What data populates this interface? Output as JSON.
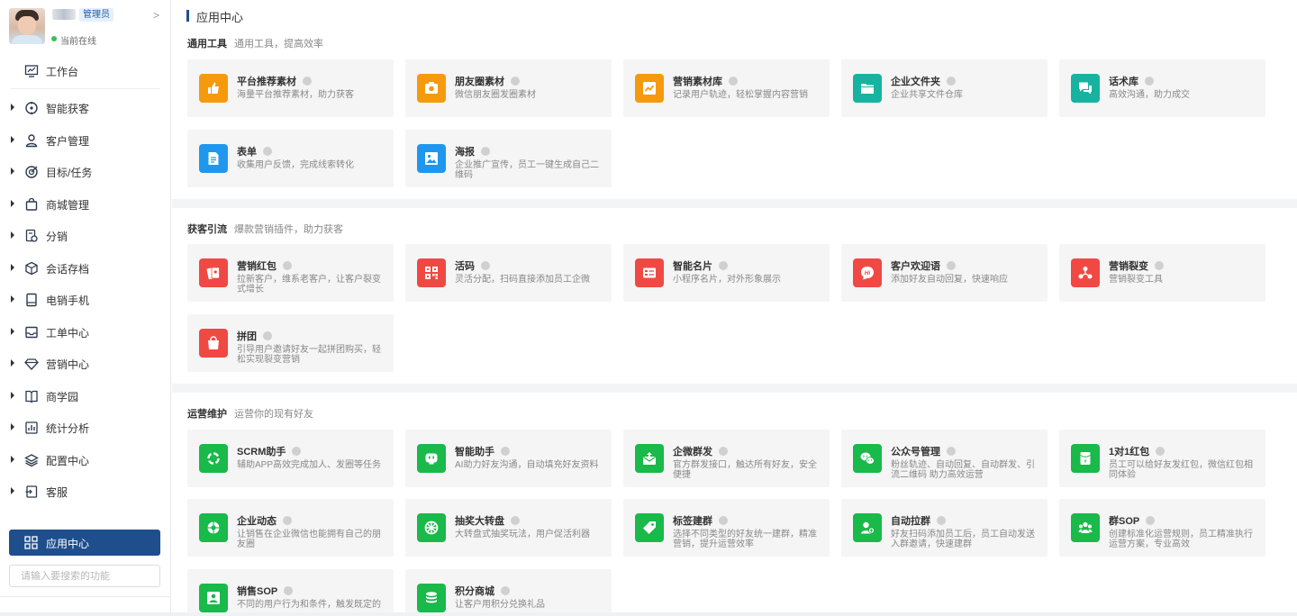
{
  "sidebar": {
    "profile": {
      "role": "管理员",
      "status": "当前在线"
    },
    "workbench": "工作台",
    "nav": [
      {
        "label": "智能获客",
        "icon": "compass-icon"
      },
      {
        "label": "客户管理",
        "icon": "user-icon"
      },
      {
        "label": "目标/任务",
        "icon": "target-icon"
      },
      {
        "label": "商城管理",
        "icon": "shopping-bag-icon"
      },
      {
        "label": "分销",
        "icon": "distribution-icon"
      },
      {
        "label": "会话存档",
        "icon": "chat-archive-icon"
      },
      {
        "label": "电销手机",
        "icon": "phone-icon"
      },
      {
        "label": "工单中心",
        "icon": "ticket-icon"
      },
      {
        "label": "营销中心",
        "icon": "diamond-icon"
      },
      {
        "label": "商学园",
        "icon": "book-icon"
      },
      {
        "label": "统计分析",
        "icon": "chart-icon"
      },
      {
        "label": "配置中心",
        "icon": "layers-icon"
      },
      {
        "label": "客服",
        "icon": "service-icon"
      }
    ],
    "active_item": "应用中心",
    "search_placeholder": "请输入要搜索的功能"
  },
  "main": {
    "title": "应用中心",
    "sections": [
      {
        "title": "通用工具",
        "subtitle": "通用工具，提高效率",
        "cards": [
          {
            "title": "平台推荐素材",
            "desc": "海量平台推荐素材，助力获客",
            "color": "#f59a0d",
            "icon": "thumbs-up-icon"
          },
          {
            "title": "朋友圈素材",
            "desc": "微信朋友圈发圈素材",
            "color": "#f59a0d",
            "icon": "camera-icon"
          },
          {
            "title": "营销素材库",
            "desc": "记录用户轨迹，轻松掌握内容营销",
            "color": "#f59a0d",
            "icon": "trend-icon"
          },
          {
            "title": "企业文件夹",
            "desc": "企业共享文件仓库",
            "color": "#18b3a0",
            "icon": "folder-icon"
          },
          {
            "title": "话术库",
            "desc": "高效沟通，助力成交",
            "color": "#18b3a0",
            "icon": "chat-bubbles-icon"
          },
          {
            "title": "表单",
            "desc": "收集用户反馈，完成线索转化",
            "color": "#1f97ee",
            "icon": "form-icon"
          },
          {
            "title": "海报",
            "desc": "企业推广宣传，员工一键生成自己二维码",
            "color": "#1f97ee",
            "icon": "poster-icon"
          }
        ]
      },
      {
        "title": "获客引流",
        "subtitle": "爆款营销插件，助力获客",
        "cards": [
          {
            "title": "营销红包",
            "desc": "拉新客户，维系老客户，让客户裂变式增长",
            "color": "#f04943",
            "icon": "red-packet-icon"
          },
          {
            "title": "活码",
            "desc": "灵活分配，扫码直接添加员工企微",
            "color": "#f04943",
            "icon": "qrcode-icon"
          },
          {
            "title": "智能名片",
            "desc": "小程序名片，对外形象展示",
            "color": "#f04943",
            "icon": "card-icon"
          },
          {
            "title": "客户欢迎语",
            "desc": "添加好友自动回复，快速响应",
            "color": "#f04943",
            "icon": "hi-icon"
          },
          {
            "title": "营销裂变",
            "desc": "营销裂变工具",
            "color": "#f04943",
            "icon": "fission-icon"
          },
          {
            "title": "拼团",
            "desc": "引导用户邀请好友一起拼团购买，轻松实现裂变营销",
            "color": "#f04943",
            "icon": "group-buy-icon"
          }
        ]
      },
      {
        "title": "运营维护",
        "subtitle": "运营你的现有好友",
        "cards": [
          {
            "title": "SCRM助手",
            "desc": "辅助APP高效完成加人、发圈等任务",
            "color": "#19b94a",
            "icon": "scrm-icon"
          },
          {
            "title": "智能助手",
            "desc": "AI助力好友沟通，自动填充好友资料",
            "color": "#19b94a",
            "icon": "robot-icon"
          },
          {
            "title": "企微群发",
            "desc": "官方群发接口，触达所有好友，安全便捷",
            "color": "#19b94a",
            "icon": "mass-send-icon"
          },
          {
            "title": "公众号管理",
            "desc": "粉丝轨迹、自动回复、自动群发、引流二维码 助力高效运营",
            "color": "#19b94a",
            "icon": "wechat-icon"
          },
          {
            "title": "1对1红包",
            "desc": "员工可以给好友发红包，微信红包相同体验",
            "color": "#19b94a",
            "icon": "yen-packet-icon"
          },
          {
            "title": "企业动态",
            "desc": "让销售在企业微信也能拥有自己的朋友圈",
            "color": "#19b94a",
            "icon": "moments-icon"
          },
          {
            "title": "抽奖大转盘",
            "desc": "大转盘式抽奖玩法，用户促活利器",
            "color": "#19b94a",
            "icon": "wheel-icon"
          },
          {
            "title": "标签建群",
            "desc": "选择不同类型的好友统一建群，精准营销，提升运营效率",
            "color": "#19b94a",
            "icon": "tag-icon"
          },
          {
            "title": "自动拉群",
            "desc": "好友扫码添加员工后，员工自动发送入群邀请，快速建群",
            "color": "#19b94a",
            "icon": "add-user-icon"
          },
          {
            "title": "群SOP",
            "desc": "创建标准化运营规则，员工精准执行运营方案，专业高效",
            "color": "#19b94a",
            "icon": "group-icon"
          },
          {
            "title": "销售SOP",
            "desc": "不同的用户行为和条件，触发既定的",
            "color": "#19b94a",
            "icon": "sales-icon"
          },
          {
            "title": "积分商城",
            "desc": "让客户用积分兑换礼品",
            "color": "#19b94a",
            "icon": "coins-icon"
          }
        ]
      }
    ]
  }
}
